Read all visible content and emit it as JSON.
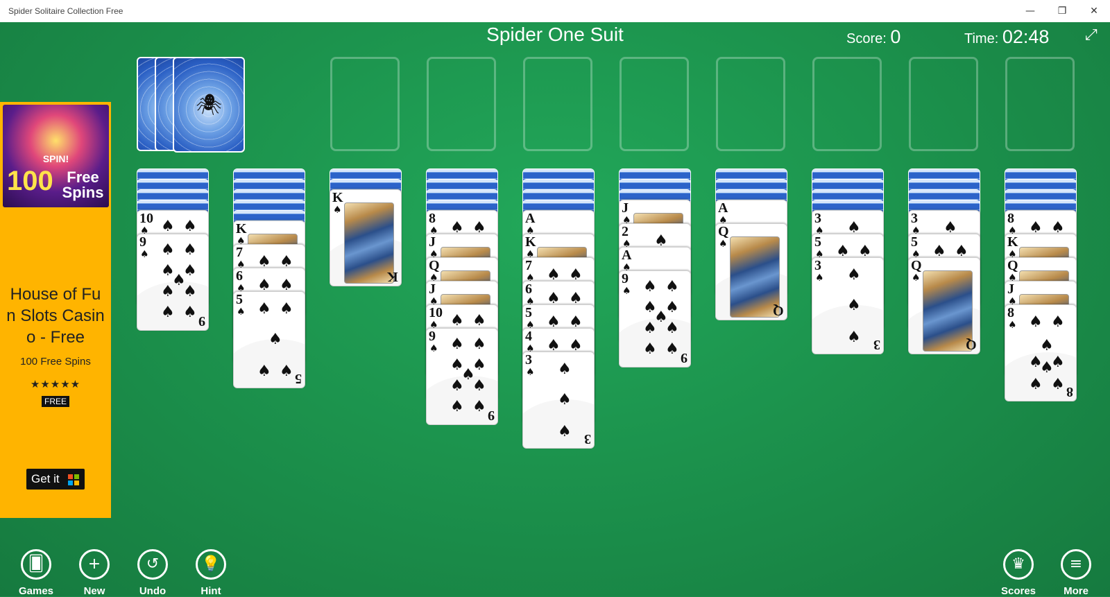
{
  "window": {
    "title": "Spider Solitaire Collection Free",
    "minimize": "—",
    "restore": "❐",
    "close": "✕"
  },
  "header": {
    "game_title": "Spider One Suit",
    "score_label": "Score:",
    "score_value": "0",
    "time_label": "Time:",
    "time_value": "02:48",
    "fullscreen_icon": "⤢"
  },
  "ad": {
    "spin": "SPIN!",
    "big": "100",
    "free_spins": "Free Spins",
    "title": "House of Fun Slots Casino - Free",
    "subtitle": "100 Free Spins",
    "stars": "★★★★★",
    "badge": "FREE",
    "cta": "Get it"
  },
  "bottom_left": [
    {
      "name": "games",
      "label": "Games",
      "icon": "🂠"
    },
    {
      "name": "new",
      "label": "New",
      "icon": "+"
    },
    {
      "name": "undo",
      "label": "Undo",
      "icon": "↺"
    },
    {
      "name": "hint",
      "label": "Hint",
      "icon": "💡"
    }
  ],
  "bottom_right": [
    {
      "name": "scores",
      "label": "Scores",
      "icon": "♛"
    },
    {
      "name": "more",
      "label": "More",
      "icon": "≡"
    }
  ],
  "tableau": [
    {
      "facedown": 4,
      "cards": [
        "10",
        "9"
      ]
    },
    {
      "facedown": 5,
      "cards": [
        "K",
        "7",
        "6",
        "5"
      ]
    },
    {
      "facedown": 2,
      "cards": [
        "K"
      ]
    },
    {
      "facedown": 4,
      "cards": [
        "8",
        "J",
        "Q",
        "J",
        "10",
        "9"
      ]
    },
    {
      "facedown": 4,
      "cards": [
        "A",
        "K",
        "7",
        "6",
        "5",
        "4",
        "3"
      ]
    },
    {
      "facedown": 3,
      "cards": [
        "J",
        "2",
        "A",
        "9"
      ]
    },
    {
      "facedown": 3,
      "cards": [
        "A",
        "Q"
      ]
    },
    {
      "facedown": 4,
      "cards": [
        "3",
        "5",
        "3"
      ]
    },
    {
      "facedown": 4,
      "cards": [
        "3",
        "5",
        "Q"
      ]
    },
    {
      "facedown": 4,
      "cards": [
        "8",
        "K",
        "Q",
        "J",
        "8"
      ]
    }
  ]
}
